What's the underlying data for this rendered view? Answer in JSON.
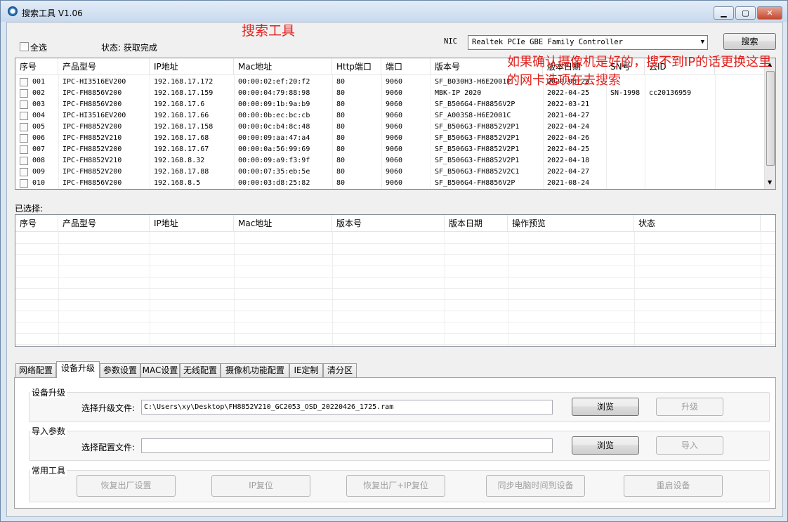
{
  "window": {
    "title": "搜索工具 V1.06",
    "minimize": "▁",
    "maximize": "▢",
    "close": "✕"
  },
  "top": {
    "select_all": "全选",
    "status": "状态: 获取完成",
    "overlay_title": "搜索工具",
    "nic_label": "NIC",
    "nic_value": "Realtek PCIe GBE Family Controller",
    "search_button": "搜索",
    "annotation": "如果确认摄像机是好的，搜不到IP的话更换这里的网卡选项在去搜索"
  },
  "device_table": {
    "headers": [
      "序号",
      "产品型号",
      "IP地址",
      "Mac地址",
      "Http端口",
      "端口",
      "版本号",
      "版本日期",
      "SN号",
      "云ID"
    ],
    "rows": [
      [
        "001",
        "IPC-HI3516EV200",
        "192.168.17.172",
        "00:00:02:ef:20:f2",
        "80",
        "9060",
        "SF_B030H3-H6E2001P",
        "2020-06-29",
        "",
        ""
      ],
      [
        "002",
        "IPC-FH8856V200",
        "192.168.17.159",
        "00:00:04:79:88:98",
        "80",
        "9060",
        "MBK-IP 2020",
        "2022-04-25",
        "SN-1998",
        "cc20136959"
      ],
      [
        "003",
        "IPC-FH8856V200",
        "192.168.17.6",
        "00:00:09:1b:9a:b9",
        "80",
        "9060",
        "SF_B506G4-FH8856V2P",
        "2022-03-21",
        "",
        ""
      ],
      [
        "004",
        "IPC-HI3516EV200",
        "192.168.17.66",
        "00:00:0b:ec:bc:cb",
        "80",
        "9060",
        "SF_A003S8-H6E2001C",
        "2021-04-27",
        "",
        ""
      ],
      [
        "005",
        "IPC-FH8852V200",
        "192.168.17.158",
        "00:00:0c:b4:8c:48",
        "80",
        "9060",
        "SF_B506G3-FH8852V2P1",
        "2022-04-24",
        "",
        ""
      ],
      [
        "006",
        "IPC-FH8852V210",
        "192.168.17.68",
        "00:00:09:aa:47:a4",
        "80",
        "9060",
        "SF_B506G3-FH8852V2P1",
        "2022-04-26",
        "",
        ""
      ],
      [
        "007",
        "IPC-FH8852V200",
        "192.168.17.67",
        "00:00:0a:56:99:69",
        "80",
        "9060",
        "SF_B506G3-FH8852V2P1",
        "2022-04-25",
        "",
        ""
      ],
      [
        "008",
        "IPC-FH8852V210",
        "192.168.8.32",
        "00:00:09:a9:f3:9f",
        "80",
        "9060",
        "SF_B506G3-FH8852V2P1",
        "2022-04-18",
        "",
        ""
      ],
      [
        "009",
        "IPC-FH8852V200",
        "192.168.17.88",
        "00:00:07:35:eb:5e",
        "80",
        "9060",
        "SF_B506G3-FH8852V2C1",
        "2022-04-27",
        "",
        ""
      ],
      [
        "010",
        "IPC-FH8856V200",
        "192.168.8.5",
        "00:00:03:d8:25:82",
        "80",
        "9060",
        "SF_B506G4-FH8856V2P",
        "2021-08-24",
        "",
        ""
      ]
    ]
  },
  "selected": {
    "label": "已选择:",
    "headers": [
      "序号",
      "产品型号",
      "IP地址",
      "Mac地址",
      "版本号",
      "版本日期",
      "操作预览",
      "状态"
    ]
  },
  "tabs": [
    "网络配置",
    "设备升级",
    "参数设置",
    "MAC设置",
    "无线配置",
    "摄像机功能配置",
    "IE定制",
    "清分区"
  ],
  "upgrade": {
    "group_title": "设备升级",
    "file_label": "选择升级文件:",
    "file_value": "C:\\Users\\xy\\Desktop\\FH8852V210_GC2053_OSD_20220426_1725.ram",
    "browse": "浏览",
    "upgrade_button": "升级"
  },
  "import": {
    "group_title": "导入参数",
    "file_label": "选择配置文件:",
    "file_value": "",
    "browse": "浏览",
    "import_button": "导入"
  },
  "tools": {
    "group_title": "常用工具",
    "buttons": [
      "恢复出厂设置",
      "IP复位",
      "恢复出厂+IP复位",
      "同步电脑时间到设备",
      "重启设备"
    ]
  },
  "colors": {
    "annotation_red": "#e0201c",
    "window_frame": "#b9d1ea"
  }
}
